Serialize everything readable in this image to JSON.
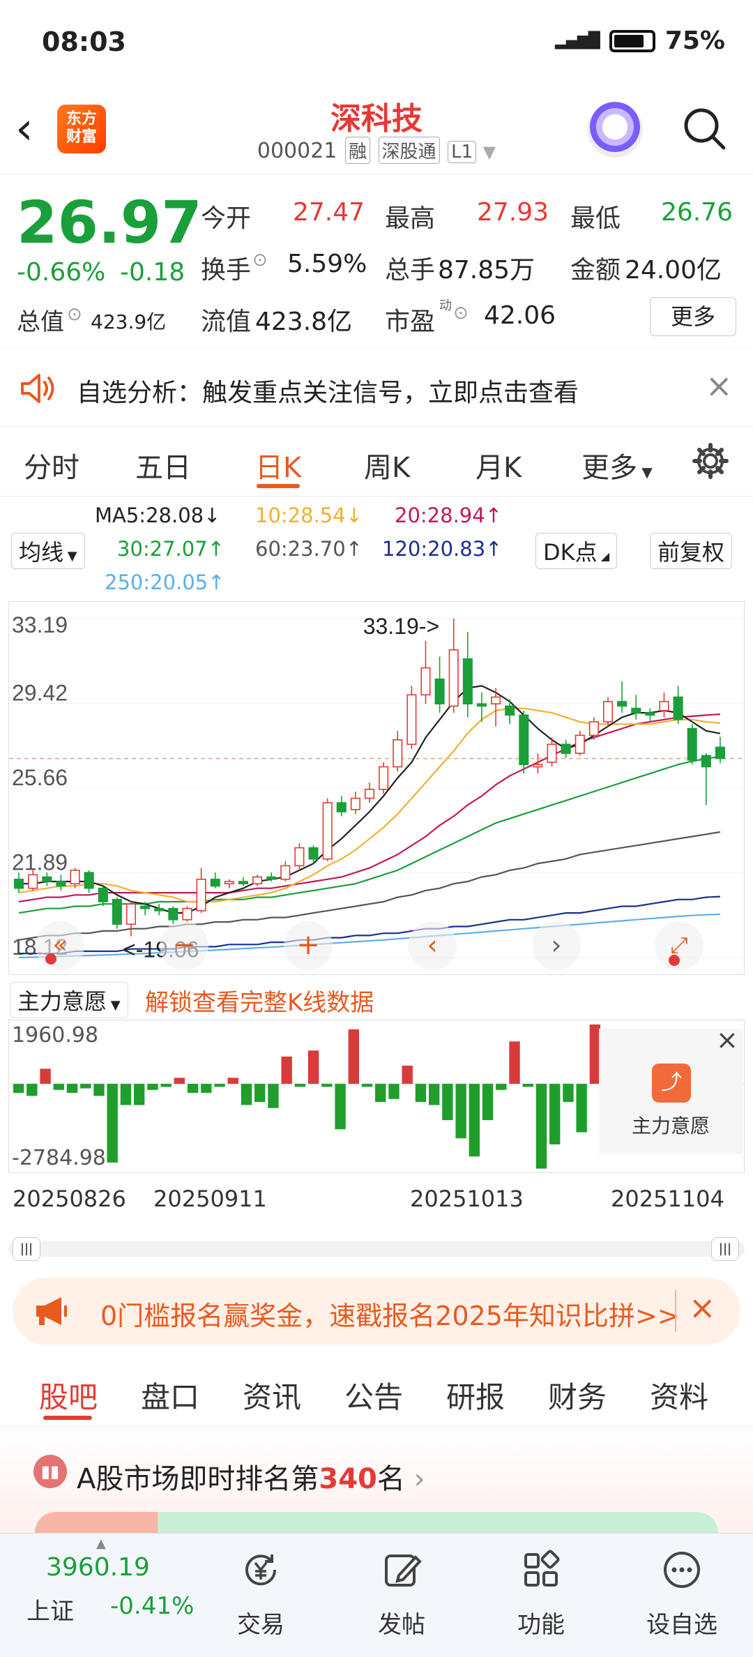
{
  "status_bar": {
    "time": "08:03",
    "network": "5G",
    "battery": "75%"
  },
  "header": {
    "logo_text": "东方\n财富",
    "stock_name": "深科技",
    "stock_code": "000021",
    "tags": [
      "融",
      "深股通",
      "L1"
    ]
  },
  "quote": {
    "price": "26.97",
    "change_pct": "-0.66%",
    "change_amt": "-0.18",
    "open_label": "今开",
    "open": "27.47",
    "high_label": "最高",
    "high": "27.93",
    "low_label": "最低",
    "low": "26.76",
    "turnover_label": "换手",
    "turnover": "5.59%",
    "volume_label": "总手",
    "volume": "87.85万",
    "amount_label": "金额",
    "amount": "24.00亿",
    "mktcap_label": "总值",
    "mktcap": "423.9亿",
    "float_label": "流值",
    "float": "423.8亿",
    "pe_label": "市盈",
    "pe_sup": "动",
    "pe": "42.06",
    "more_label": "更多"
  },
  "notice": {
    "text": "自选分析：触发重点关注信号，立即点击查看"
  },
  "kline_tabs": {
    "items": [
      "分时",
      "五日",
      "日K",
      "周K",
      "月K",
      "更多"
    ],
    "active": "日K"
  },
  "ma_legend": {
    "selector": "均线",
    "ma5": "MA5:28.08↓",
    "ma10": "10:28.54↓",
    "ma20": "20:28.94↑",
    "ma30": "30:27.07↑",
    "ma60": "60:23.70↑",
    "ma120": "120:20.83↑",
    "ma250": "250:20.05↑",
    "dk_label": "DK点",
    "adjust_label": "前复权",
    "colors": {
      "ma5": "#222222",
      "ma10": "#f0b030",
      "ma20": "#c2185b",
      "ma30": "#1a9f3b",
      "ma60": "#555555",
      "ma120": "#1a2f8f",
      "ma250": "#5ab0e8"
    }
  },
  "chart_data": {
    "type": "candlestick",
    "y_ticks": [
      "33.19",
      "29.42",
      "25.66",
      "21.89",
      "18.12"
    ],
    "ylim": [
      18.12,
      33.19
    ],
    "high_label": "33.19->",
    "low_label": "<-19.06",
    "x_labels": [
      "20250826",
      "20250911",
      "20251013",
      "20251104"
    ],
    "candles": [
      {
        "o": 21.6,
        "c": 21.2,
        "h": 21.9,
        "l": 21.0
      },
      {
        "o": 21.2,
        "c": 21.8,
        "h": 22.0,
        "l": 21.1
      },
      {
        "o": 21.7,
        "c": 21.5,
        "h": 21.9,
        "l": 21.3
      },
      {
        "o": 21.5,
        "c": 21.3,
        "h": 21.8,
        "l": 21.1
      },
      {
        "o": 21.4,
        "c": 22.0,
        "h": 22.1,
        "l": 21.2
      },
      {
        "o": 21.9,
        "c": 21.2,
        "h": 22.0,
        "l": 21.0
      },
      {
        "o": 21.2,
        "c": 20.6,
        "h": 21.3,
        "l": 20.4
      },
      {
        "o": 20.7,
        "c": 19.6,
        "h": 20.8,
        "l": 19.4
      },
      {
        "o": 19.6,
        "c": 20.5,
        "h": 20.6,
        "l": 19.06
      },
      {
        "o": 20.4,
        "c": 20.3,
        "h": 20.6,
        "l": 20.0
      },
      {
        "o": 20.3,
        "c": 20.2,
        "h": 20.5,
        "l": 20.0
      },
      {
        "o": 20.3,
        "c": 19.8,
        "h": 20.4,
        "l": 19.6
      },
      {
        "o": 19.8,
        "c": 20.3,
        "h": 20.4,
        "l": 19.7
      },
      {
        "o": 20.2,
        "c": 21.6,
        "h": 22.1,
        "l": 20.1
      },
      {
        "o": 21.6,
        "c": 21.3,
        "h": 21.9,
        "l": 21.2
      },
      {
        "o": 21.4,
        "c": 21.5,
        "h": 21.6,
        "l": 21.2
      },
      {
        "o": 21.5,
        "c": 21.4,
        "h": 21.7,
        "l": 21.3
      },
      {
        "o": 21.4,
        "c": 21.7,
        "h": 21.8,
        "l": 21.3
      },
      {
        "o": 21.7,
        "c": 21.6,
        "h": 21.9,
        "l": 21.5
      },
      {
        "o": 21.6,
        "c": 22.2,
        "h": 22.4,
        "l": 21.5
      },
      {
        "o": 22.2,
        "c": 23.0,
        "h": 23.2,
        "l": 22.0
      },
      {
        "o": 23.0,
        "c": 22.5,
        "h": 23.1,
        "l": 22.3
      },
      {
        "o": 22.5,
        "c": 25.0,
        "h": 25.2,
        "l": 22.4
      },
      {
        "o": 25.0,
        "c": 24.6,
        "h": 25.3,
        "l": 24.4
      },
      {
        "o": 24.7,
        "c": 25.2,
        "h": 25.5,
        "l": 24.5
      },
      {
        "o": 25.2,
        "c": 25.6,
        "h": 25.9,
        "l": 25.0
      },
      {
        "o": 25.6,
        "c": 26.6,
        "h": 26.8,
        "l": 25.4
      },
      {
        "o": 26.6,
        "c": 27.8,
        "h": 28.2,
        "l": 26.4
      },
      {
        "o": 27.6,
        "c": 29.8,
        "h": 30.2,
        "l": 27.4
      },
      {
        "o": 29.8,
        "c": 31.0,
        "h": 32.2,
        "l": 29.4
      },
      {
        "o": 30.5,
        "c": 29.4,
        "h": 31.5,
        "l": 29.0
      },
      {
        "o": 29.3,
        "c": 31.8,
        "h": 33.19,
        "l": 29.0
      },
      {
        "o": 31.4,
        "c": 29.4,
        "h": 32.6,
        "l": 28.8
      },
      {
        "o": 29.4,
        "c": 29.3,
        "h": 29.9,
        "l": 28.6
      },
      {
        "o": 29.4,
        "c": 29.7,
        "h": 30.1,
        "l": 28.4
      },
      {
        "o": 29.3,
        "c": 28.9,
        "h": 29.6,
        "l": 28.5
      },
      {
        "o": 28.9,
        "c": 26.7,
        "h": 29.1,
        "l": 26.3
      },
      {
        "o": 26.6,
        "c": 26.7,
        "h": 27.2,
        "l": 26.3
      },
      {
        "o": 26.8,
        "c": 27.6,
        "h": 27.9,
        "l": 26.6
      },
      {
        "o": 27.6,
        "c": 27.2,
        "h": 27.8,
        "l": 27.0
      },
      {
        "o": 27.2,
        "c": 28.0,
        "h": 28.2,
        "l": 27.1
      },
      {
        "o": 28.0,
        "c": 28.6,
        "h": 28.8,
        "l": 27.8
      },
      {
        "o": 28.6,
        "c": 29.5,
        "h": 29.7,
        "l": 28.4
      },
      {
        "o": 29.5,
        "c": 29.3,
        "h": 30.4,
        "l": 29.0
      },
      {
        "o": 29.2,
        "c": 29.0,
        "h": 29.8,
        "l": 28.7
      },
      {
        "o": 29.0,
        "c": 28.9,
        "h": 29.2,
        "l": 28.6
      },
      {
        "o": 29.1,
        "c": 29.5,
        "h": 29.9,
        "l": 28.8
      },
      {
        "o": 29.7,
        "c": 28.7,
        "h": 30.2,
        "l": 28.5
      },
      {
        "o": 28.3,
        "c": 26.9,
        "h": 28.5,
        "l": 26.7
      },
      {
        "o": 27.1,
        "c": 26.6,
        "h": 27.2,
        "l": 24.9
      },
      {
        "o": 27.47,
        "c": 26.97,
        "h": 27.93,
        "l": 26.76
      }
    ],
    "ma5": [
      21.4,
      21.4,
      21.5,
      21.5,
      21.5,
      21.5,
      21.3,
      20.9,
      20.6,
      20.5,
      20.3,
      20.1,
      20.1,
      20.4,
      20.8,
      21.0,
      21.2,
      21.5,
      21.6,
      21.7,
      22.0,
      22.3,
      22.9,
      23.4,
      24.0,
      24.6,
      25.3,
      26.1,
      26.8,
      27.9,
      28.7,
      29.5,
      30.1,
      30.2,
      29.9,
      29.5,
      28.9,
      28.3,
      27.8,
      27.4,
      27.6,
      28.0,
      28.4,
      28.8,
      29.0,
      29.0,
      29.1,
      29.0,
      28.6,
      28.2,
      28.08
    ],
    "ma10": [
      21.0,
      21.1,
      21.2,
      21.3,
      21.3,
      21.4,
      21.4,
      21.3,
      21.1,
      21.0,
      20.9,
      20.8,
      20.6,
      20.6,
      20.6,
      20.7,
      20.8,
      20.9,
      21.0,
      21.2,
      21.5,
      21.8,
      22.2,
      22.5,
      22.9,
      23.4,
      23.9,
      24.5,
      25.2,
      25.9,
      26.6,
      27.3,
      28.1,
      28.7,
      29.1,
      29.2,
      29.2,
      29.1,
      29.0,
      28.8,
      28.6,
      28.5,
      28.5,
      28.5,
      28.5,
      28.5,
      28.6,
      28.7,
      28.7,
      28.6,
      28.54
    ],
    "ma20": [
      20.6,
      20.7,
      20.8,
      20.8,
      20.9,
      20.9,
      21.0,
      21.0,
      21.0,
      21.0,
      21.0,
      21.0,
      21.0,
      21.0,
      21.0,
      21.0,
      21.1,
      21.2,
      21.2,
      21.3,
      21.4,
      21.5,
      21.6,
      21.7,
      21.9,
      22.1,
      22.4,
      22.7,
      23.1,
      23.5,
      24.0,
      24.4,
      24.9,
      25.3,
      25.8,
      26.2,
      26.5,
      26.8,
      27.1,
      27.4,
      27.7,
      27.9,
      28.1,
      28.3,
      28.5,
      28.6,
      28.7,
      28.8,
      28.85,
      28.9,
      28.94
    ],
    "ma30": [
      20.1,
      20.2,
      20.3,
      20.3,
      20.4,
      20.4,
      20.5,
      20.5,
      20.5,
      20.5,
      20.6,
      20.6,
      20.6,
      20.6,
      20.7,
      20.7,
      20.7,
      20.8,
      20.8,
      20.9,
      21.0,
      21.1,
      21.2,
      21.3,
      21.4,
      21.6,
      21.8,
      22.0,
      22.3,
      22.6,
      22.9,
      23.2,
      23.5,
      23.8,
      24.1,
      24.3,
      24.5,
      24.7,
      24.9,
      25.1,
      25.3,
      25.5,
      25.7,
      25.9,
      26.1,
      26.3,
      26.5,
      26.7,
      26.85,
      26.95,
      27.07
    ],
    "ma60": [
      18.9,
      19.0,
      19.1,
      19.1,
      19.2,
      19.2,
      19.3,
      19.3,
      19.4,
      19.4,
      19.5,
      19.5,
      19.6,
      19.6,
      19.7,
      19.7,
      19.8,
      19.8,
      19.9,
      19.9,
      20.0,
      20.1,
      20.2,
      20.3,
      20.4,
      20.5,
      20.6,
      20.8,
      20.9,
      21.1,
      21.2,
      21.4,
      21.5,
      21.7,
      21.8,
      22.0,
      22.1,
      22.3,
      22.4,
      22.5,
      22.7,
      22.8,
      22.9,
      23.0,
      23.1,
      23.2,
      23.3,
      23.4,
      23.5,
      23.6,
      23.7
    ],
    "ma120": [
      18.3,
      18.3,
      18.3,
      18.3,
      18.4,
      18.4,
      18.4,
      18.4,
      18.5,
      18.5,
      18.5,
      18.5,
      18.6,
      18.6,
      18.6,
      18.7,
      18.7,
      18.7,
      18.8,
      18.8,
      18.9,
      18.9,
      19.0,
      19.0,
      19.1,
      19.1,
      19.2,
      19.2,
      19.3,
      19.4,
      19.4,
      19.5,
      19.5,
      19.6,
      19.7,
      19.8,
      19.8,
      19.9,
      20.0,
      20.1,
      20.1,
      20.2,
      20.3,
      20.4,
      20.4,
      20.5,
      20.6,
      20.7,
      20.7,
      20.8,
      20.83
    ],
    "ma250": [
      18.12,
      18.13,
      18.15,
      18.17,
      18.19,
      18.21,
      18.23,
      18.25,
      18.28,
      18.3,
      18.33,
      18.36,
      18.39,
      18.42,
      18.45,
      18.48,
      18.52,
      18.55,
      18.58,
      18.62,
      18.66,
      18.7,
      18.74,
      18.78,
      18.82,
      18.86,
      18.9,
      18.95,
      19.0,
      19.05,
      19.1,
      19.15,
      19.2,
      19.25,
      19.3,
      19.35,
      19.4,
      19.45,
      19.5,
      19.55,
      19.6,
      19.65,
      19.7,
      19.75,
      19.8,
      19.85,
      19.9,
      19.95,
      19.99,
      20.02,
      20.05
    ]
  },
  "flow_panel": {
    "selector": "主力意愿",
    "unlock_text": "解锁查看完整K线数据",
    "ymax_label": "1960.98",
    "ymin_label": "-2784.98",
    "ylim": [
      -2784.98,
      1960.98
    ],
    "values": [
      -300,
      -400,
      500,
      -200,
      -300,
      -150,
      -400,
      -2600,
      -700,
      -700,
      -200,
      -100,
      200,
      -300,
      -300,
      -100,
      200,
      -700,
      -600,
      -800,
      900,
      -100,
      1100,
      -100,
      -1500,
      1800,
      -100,
      -600,
      -500,
      600,
      -600,
      -700,
      -1200,
      -1800,
      -2400,
      -1200,
      -200,
      1400,
      -100,
      -2800,
      -2000,
      -600,
      -1600,
      1960
    ]
  },
  "flow_lock": {
    "label": "主力意愿"
  },
  "promo": {
    "text": "0门槛报名赢奖金，速戳报名2025年知识比拼>>"
  },
  "section_tabs": {
    "items": [
      "股吧",
      "盘口",
      "资讯",
      "公告",
      "研报",
      "财务",
      "资料"
    ],
    "active": "股吧"
  },
  "rank": {
    "prefix": "A股市场即时排名第",
    "rank": "340",
    "suffix": "名"
  },
  "bottom_nav": {
    "index_value": "3960.19",
    "index_name": "上证",
    "index_change": "-0.41%",
    "items": [
      "交易",
      "发帖",
      "功能",
      "设自选"
    ]
  }
}
